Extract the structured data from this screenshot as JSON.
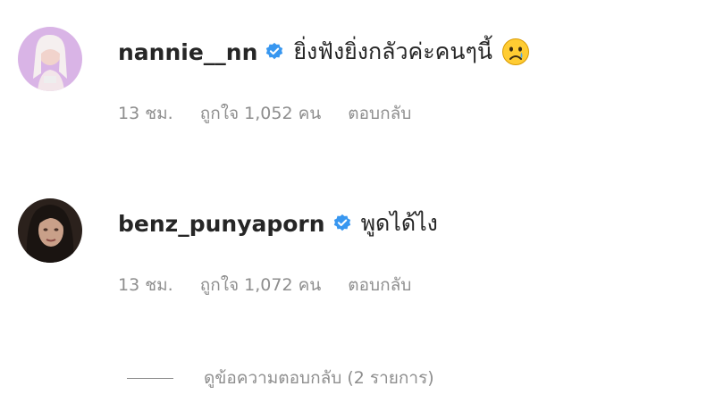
{
  "comments": [
    {
      "username": "nannie__nn",
      "verified": true,
      "text": "ยิ่งฟังยิ่งกลัวค่ะคนๆนี้",
      "emoji": "crying-face",
      "time": "13 ชม.",
      "likes": "ถูกใจ 1,052 คน",
      "reply_label": "ตอบกลับ"
    },
    {
      "username": "benz_punyaporn",
      "verified": true,
      "text": "พูดได้ไง",
      "time": "13 ชม.",
      "likes": "ถูกใจ 1,072 คน",
      "reply_label": "ตอบกลับ"
    }
  ],
  "view_replies": "ดูข้อความตอบกลับ (2 รายการ)",
  "colors": {
    "text_primary": "#262626",
    "text_secondary": "#8e8e8e",
    "verified_blue": "#3897f0"
  }
}
